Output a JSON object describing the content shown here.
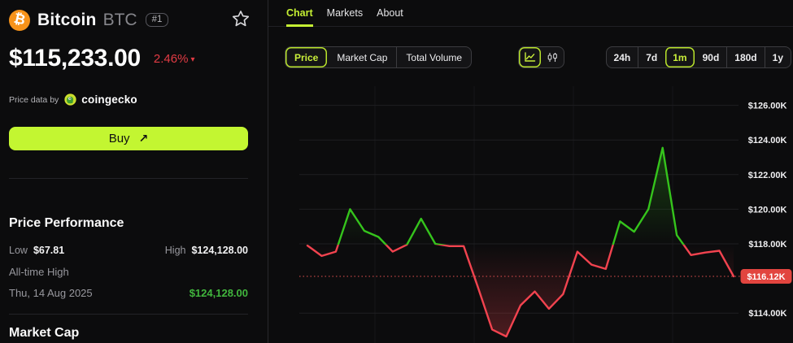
{
  "sidebar": {
    "coin_name": "Bitcoin",
    "symbol": "BTC",
    "rank": "#1",
    "price": "$115,233.00",
    "change_pct": "2.46%",
    "change_arrow": "▾",
    "attribution_prefix": "Price data by",
    "attribution_brand": "coingecko",
    "buy_label": "Buy",
    "buy_arrow": "↗",
    "performance_title": "Price Performance",
    "low_label": "Low",
    "low_value": "$67.81",
    "high_label": "High",
    "high_value": "$124,128.00",
    "ath_label": "All-time High",
    "ath_date": "Thu, 14 Aug 2025",
    "ath_value": "$124,128.00",
    "market_cap_title": "Market Cap"
  },
  "tabs": [
    {
      "label": "Chart",
      "active": true
    },
    {
      "label": "Markets",
      "active": false
    },
    {
      "label": "About",
      "active": false
    }
  ],
  "controls": {
    "metrics": [
      {
        "label": "Price",
        "active": true
      },
      {
        "label": "Market Cap",
        "active": false
      },
      {
        "label": "Total Volume",
        "active": false
      }
    ],
    "chart_types": [
      {
        "name": "line-chart",
        "active": true
      },
      {
        "name": "candlestick",
        "active": false
      }
    ],
    "ranges": [
      {
        "label": "24h",
        "active": false
      },
      {
        "label": "7d",
        "active": false
      },
      {
        "label": "1m",
        "active": true
      },
      {
        "label": "90d",
        "active": false
      },
      {
        "label": "180d",
        "active": false
      },
      {
        "label": "1y",
        "active": false
      }
    ]
  },
  "chart_data": {
    "type": "line",
    "values_k": [
      117.9,
      117.3,
      117.55,
      120.0,
      118.75,
      118.4,
      117.55,
      117.95,
      119.45,
      118.0,
      117.87,
      117.87,
      115.5,
      113.05,
      112.65,
      114.45,
      115.25,
      114.25,
      115.1,
      117.55,
      116.8,
      116.55,
      119.3,
      118.7,
      120.0,
      123.55,
      118.5,
      117.35,
      117.5,
      117.6,
      116.12
    ],
    "baseline_k": 117.95,
    "current_price_k": 116.12,
    "current_price_label": "$116.12K",
    "y_ticks": [
      {
        "label": "$126.00K",
        "value_k": 126
      },
      {
        "label": "$124.00K",
        "value_k": 124
      },
      {
        "label": "$122.00K",
        "value_k": 122
      },
      {
        "label": "$120.00K",
        "value_k": 120
      },
      {
        "label": "$118.00K",
        "value_k": 118
      },
      {
        "label": "$114.00K",
        "value_k": 114
      }
    ],
    "ylim_k": [
      112.3,
      127.4
    ],
    "grid": "horizontal",
    "legend": "none",
    "up_color": "#35c41c",
    "down_color": "#f2434f"
  },
  "colors": {
    "accent_lime": "#c3f631",
    "change_red": "#e23b44",
    "ath_green": "#41b63d",
    "badge_red": "#e2453f",
    "bitcoin_orange": "#f7931a"
  }
}
